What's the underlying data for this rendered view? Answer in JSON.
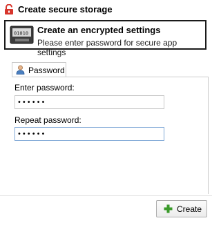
{
  "window": {
    "title": "Create secure storage",
    "title_icon": "lock-icon"
  },
  "header": {
    "icon": "safe-icon",
    "title": "Create an encrypted settings",
    "subtitle": "Please enter password for secure app settings"
  },
  "tabs": [
    {
      "label": "Password",
      "icon": "user-icon",
      "selected": true
    }
  ],
  "form": {
    "password_label": "Enter password:",
    "password_value": "••••••",
    "repeat_label": "Repeat password:",
    "repeat_value": "••••••"
  },
  "footer": {
    "create_label": "Create",
    "create_icon": "plus-icon"
  },
  "colors": {
    "lock_red": "#d7352c",
    "plus_green": "#3a9a2a",
    "focus_border": "#7fa8d6"
  }
}
